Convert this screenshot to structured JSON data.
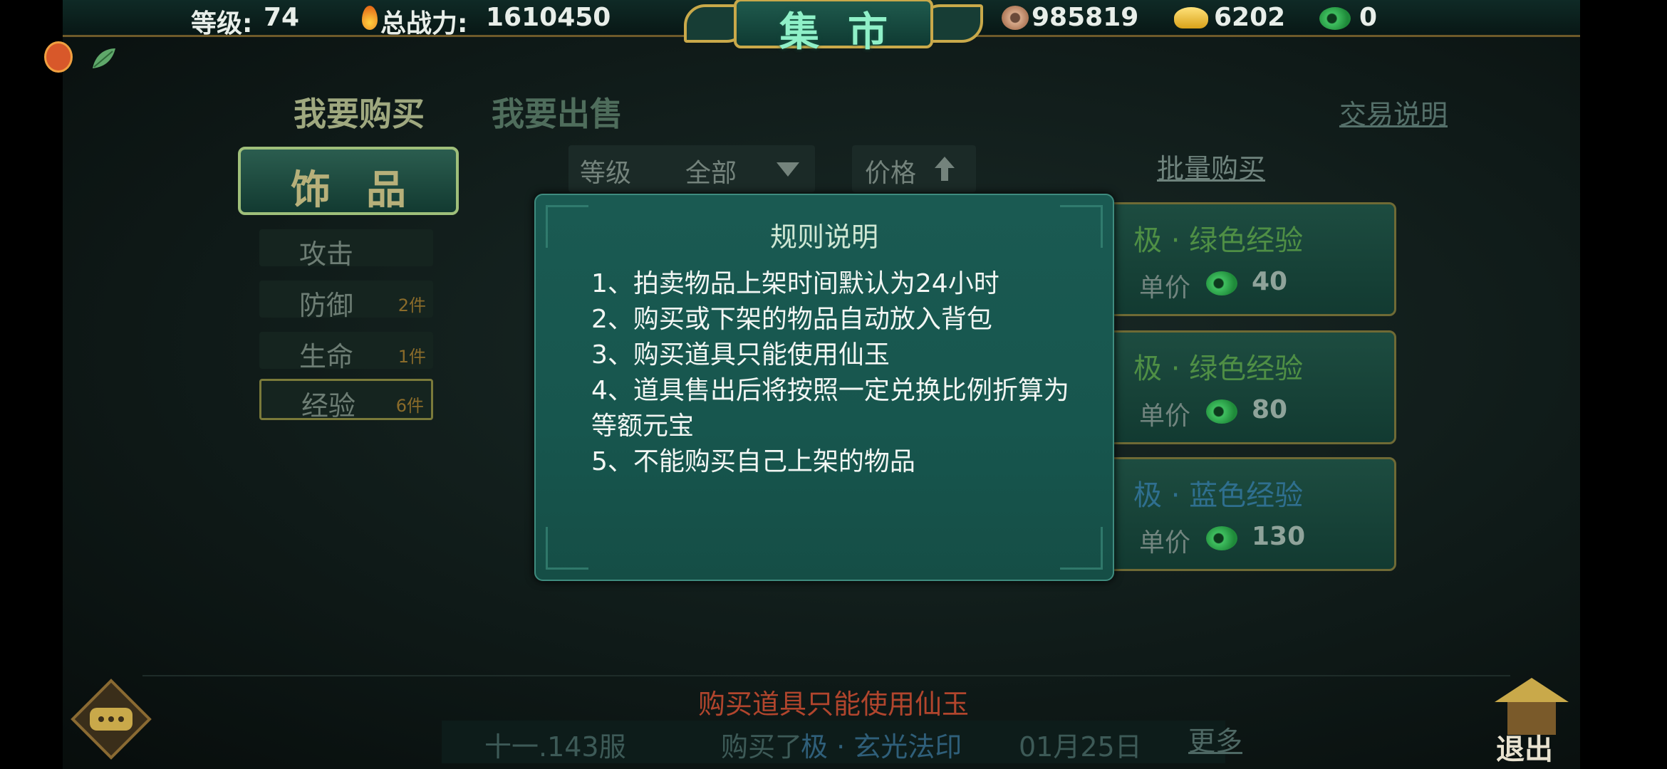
{
  "header": {
    "level_label": "等级:",
    "level_value": "74",
    "power_label": "总战力:",
    "power_value": "1610450",
    "title": "集市",
    "copper_value": "985819",
    "gold_value": "6202",
    "jade_value": "0"
  },
  "tabs": {
    "buy": "我要购买",
    "sell": "我要出售"
  },
  "help_link": "交易说明",
  "category": {
    "main": "饰品",
    "subs": [
      {
        "name": "攻击",
        "count": ""
      },
      {
        "name": "防御",
        "count": "2件"
      },
      {
        "name": "生命",
        "count": "1件"
      },
      {
        "name": "经验",
        "count": "6件"
      }
    ]
  },
  "filters": {
    "level_label": "等级",
    "level_value": "全部",
    "price_label": "价格",
    "bulk_buy": "批量购买"
  },
  "items": [
    {
      "name": "极 · 绿色经验",
      "price_label": "单价",
      "price": "40",
      "color": "#4f8f45"
    },
    {
      "name": "极 · 绿色经验",
      "price_label": "单价",
      "price": "80",
      "color": "#4f8f45"
    },
    {
      "name": "极 · 蓝色经验",
      "price_label": "单价",
      "price": "130",
      "color": "#2f6f8f"
    }
  ],
  "modal": {
    "title": "规则说明",
    "rules": [
      "1、拍卖物品上架时间默认为24小时",
      "2、购买或下架的物品自动放入背包",
      "3、购买道具只能使用仙玉",
      "4、道具售出后将按照一定兑换比例折算为等额元宝",
      "5、不能购买自己上架的物品"
    ]
  },
  "bottom": {
    "notice": "购买道具只能使用仙玉",
    "ticker_server": "十一.143服",
    "ticker_action": "购买了",
    "ticker_item": "极 · 玄光法印",
    "ticker_date": "01月25日",
    "more": "更多",
    "exit": "退出"
  },
  "colors": {
    "accent_gold": "#c9a94a",
    "jade_green": "#3aa05a",
    "notice_red": "#b1452d"
  }
}
